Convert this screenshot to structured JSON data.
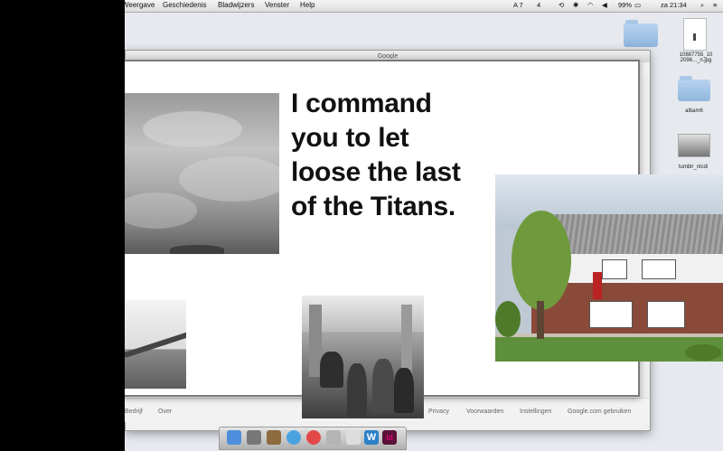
{
  "menubar": {
    "items": [
      "Weergave",
      "Geschiedenis",
      "Bladwijzers",
      "Venster",
      "Help"
    ],
    "status": {
      "badge_a": "A 7",
      "badge_b": "4",
      "battery": "99%",
      "clock": "za 21:34"
    }
  },
  "browser": {
    "title": "Google",
    "footer_left": [
      "Bedrijf",
      "Over"
    ],
    "footer_right": [
      "Privacy",
      "Voorwaarden",
      "Instellingen",
      "Google.com gebruiken"
    ]
  },
  "quote": {
    "line1": "I command",
    "line2": "you to let",
    "line3": "loose the last",
    "line4": "of the Titans."
  },
  "desktop": {
    "icons": [
      {
        "label": "albam6",
        "type": "folder"
      },
      {
        "label": "10887755_10\n2096..._n.jpg",
        "type": "image"
      },
      {
        "label": "tumblr_nlcdi",
        "type": "image"
      }
    ]
  },
  "dock": {
    "apps": [
      "finder-icon",
      "safari-icon",
      "photos-icon",
      "appstore-icon",
      "itunes-icon",
      "preview-icon",
      "game-icon",
      "word-icon",
      "indesign-icon"
    ]
  }
}
